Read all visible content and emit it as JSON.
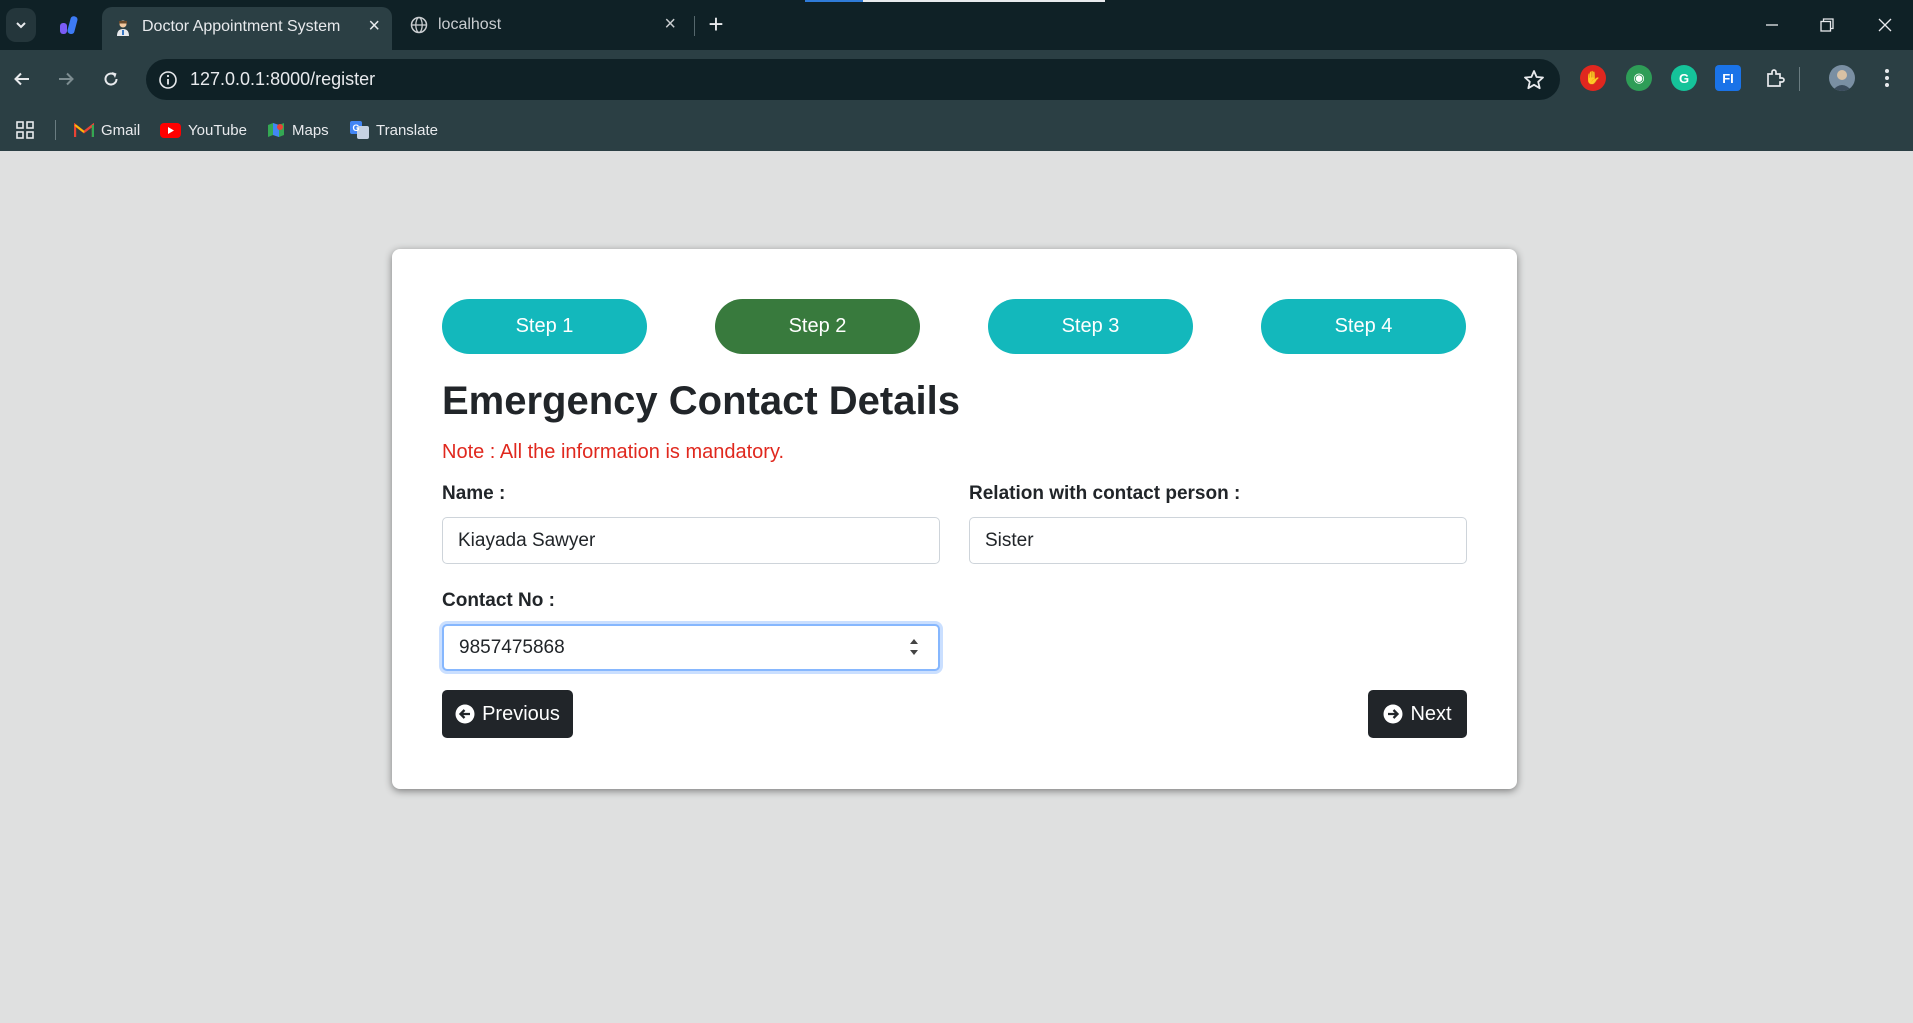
{
  "browser": {
    "tabs": [
      {
        "title": "Doctor Appointment System",
        "active": true
      },
      {
        "title": "localhost",
        "active": false
      }
    ],
    "url": "127.0.0.1:8000/register",
    "bookmarks": [
      {
        "label": "Gmail",
        "icon": "gmail-icon"
      },
      {
        "label": "YouTube",
        "icon": "youtube-icon"
      },
      {
        "label": "Maps",
        "icon": "maps-icon"
      },
      {
        "label": "Translate",
        "icon": "translate-icon"
      }
    ],
    "extensions": [
      {
        "name": "adblock-icon",
        "text": "✋",
        "color": "#e0271f"
      },
      {
        "name": "chatgpt-extension-icon",
        "text": "◉",
        "color": "#2e9d57"
      },
      {
        "name": "grammarly-icon",
        "text": "G",
        "color": "#15c39a"
      },
      {
        "name": "fi-extension-icon",
        "text": "FI",
        "color": "#1a73e8"
      }
    ]
  },
  "form": {
    "steps": [
      "Step 1",
      "Step 2",
      "Step 3",
      "Step 4"
    ],
    "active_step": 2,
    "title": "Emergency Contact Details",
    "note": "Note : All the information is mandatory.",
    "fields": {
      "name": {
        "label": "Name :",
        "value": "Kiayada Sawyer"
      },
      "relation": {
        "label": "Relation with contact person :",
        "value": "Sister"
      },
      "contact": {
        "label": "Contact No :",
        "value": "9857475868"
      }
    },
    "buttons": {
      "previous": "Previous",
      "next": "Next"
    }
  },
  "colors": {
    "step_default": "#13b8bc",
    "step_active": "#387a3d",
    "note": "#e0281e",
    "button": "#212529",
    "page_background": "#dfe0e0"
  }
}
